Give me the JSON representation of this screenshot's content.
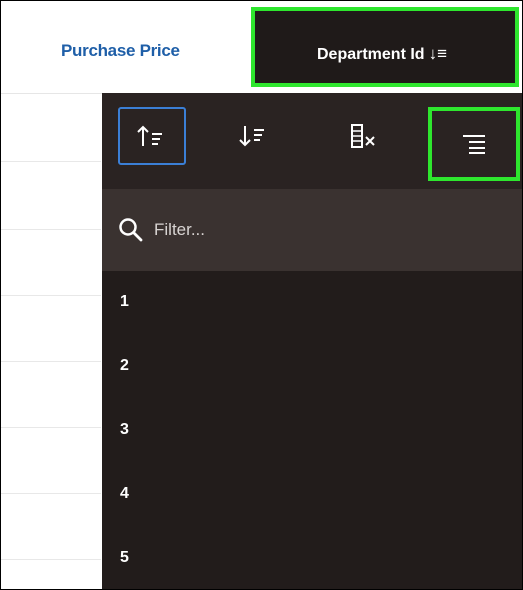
{
  "header": {
    "purchase_price_label": "Purchase Price",
    "department_label": "Department Id",
    "sort_indicator": "↓≡"
  },
  "toolbar": {
    "buttons": [
      {
        "name": "sort-ascending-icon",
        "glyph": "↑≡"
      },
      {
        "name": "sort-descending-icon",
        "glyph": "↓≣"
      },
      {
        "name": "hide-column-icon",
        "glyph": "▥×"
      },
      {
        "name": "control-break-icon",
        "glyph": "≣"
      }
    ]
  },
  "filter": {
    "placeholder": "Filter..."
  },
  "values": [
    {
      "label": "1"
    },
    {
      "label": "2"
    },
    {
      "label": "3"
    },
    {
      "label": "4"
    },
    {
      "label": "5"
    }
  ],
  "colors": {
    "accent_blue": "#1f5fa8",
    "highlight_green": "#2ee62e",
    "menu_bg": "#2a2322"
  }
}
